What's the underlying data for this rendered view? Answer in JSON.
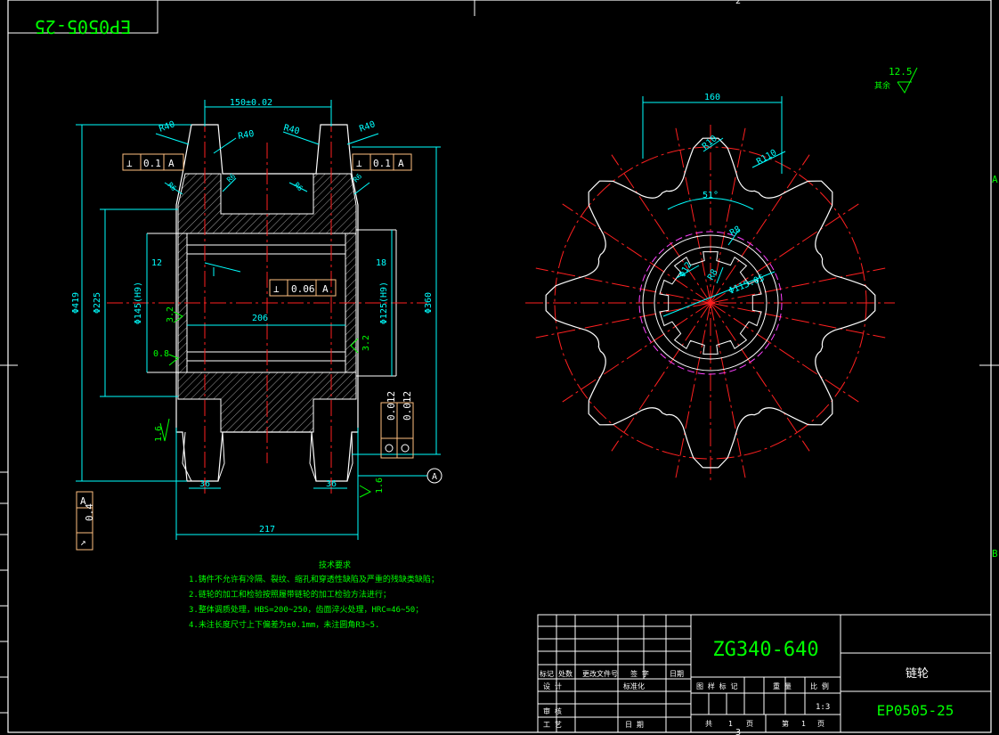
{
  "drawing_number": "EP0505-25",
  "material": "ZG340-640",
  "part_name": "链轮",
  "scale": "1:3",
  "sheet_info": {
    "total_label": "共",
    "total": "1",
    "page_unit": "页",
    "sheet_label": "第",
    "sheet": "1",
    "sheet_unit": "页"
  },
  "title_block": {
    "row_headers": [
      "标记",
      "处数",
      "更改文件号",
      "签 字",
      "日期"
    ],
    "labels": {
      "design": "设 计",
      "standardize": "标准化",
      "review": "审 核",
      "process": "工 艺",
      "approve_date": "日 期",
      "stage_mark": "图 样 标 记",
      "weight": "重 量",
      "ratio": "比 例"
    }
  },
  "roughness_general": {
    "value": "12.5",
    "note": "其余"
  },
  "tech_requirements": {
    "title": "技术要求",
    "items": [
      "1.铸件不允许有冷隔、裂纹、缩孔和穿透性缺陷及严重的残缺类缺陷；",
      "2.链轮的加工和检验按照履带链轮的加工检验方法进行；",
      "3.整体调质处理，HBS=200~250，齿面淬火处理，HRC=46~50；",
      "4.未注长度尺寸上下偏差为±0.1mm，未注圆角R3~5."
    ]
  },
  "section_view": {
    "dims": {
      "top_span": "150±0.02",
      "width_bottom": "217",
      "inner_width": "206",
      "left_od": "Φ419",
      "left_mid": "Φ225",
      "left_bore": "Φ145(H9)",
      "right_od": "Φ360",
      "right_bore": "Φ125(H9)",
      "chamfer_r": "R40",
      "chamfer_r2": "R40",
      "r_small": "R6",
      "left_step": "12",
      "right_step": "18",
      "bottom_tooth": "36",
      "rough_32": "3.2",
      "rough_08": "0.8",
      "rough_16": "1.6",
      "rough_r32": "3.2",
      "rough_r16": "1.6"
    },
    "tolerances": {
      "perp_top_left": {
        "sym": "⊥",
        "val": "0.1",
        "ref": "A"
      },
      "perp_top_right": {
        "sym": "⊥",
        "val": "0.1",
        "ref": "A"
      },
      "perp_center": {
        "sym": "⊥",
        "val": "0.06",
        "ref": "A"
      },
      "runout_left": {
        "sym": "↗",
        "val": "0.4",
        "ref": "A"
      },
      "circ_right": {
        "val1": "0.012",
        "val2": "0.012"
      }
    },
    "datum": "A"
  },
  "front_view": {
    "dims": {
      "width": "160",
      "angle": "51°",
      "tooth_r1": "R10",
      "tooth_r2": "R110",
      "spline_r": "R8",
      "spline_d": "Φ12",
      "bore_d": "Φ115.05"
    }
  },
  "frame_marks": {
    "top": "2",
    "bottom": "3",
    "right_a": "A",
    "right_b": "B"
  },
  "colors": {
    "frame": "#ffffff",
    "dim": "#00ffff",
    "center": "#ff2020",
    "text": "#00ff00",
    "hatch": "#c8c8c8",
    "tol": "#ffc080"
  }
}
